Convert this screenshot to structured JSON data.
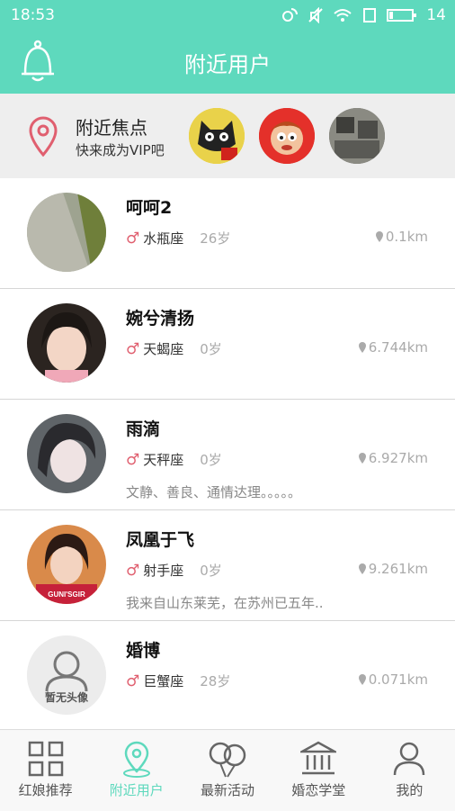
{
  "status_bar": {
    "time": "18:53",
    "battery": "14"
  },
  "header": {
    "title": "附近用户"
  },
  "focus": {
    "title": "附近焦点",
    "subtitle": "快来成为VIP吧"
  },
  "users": [
    {
      "name": "呵呵2",
      "zodiac": "水瓶座",
      "age": "26岁",
      "distance": "0.1km",
      "signature": ""
    },
    {
      "name": "婉兮清扬",
      "zodiac": "天蝎座",
      "age": "0岁",
      "distance": "6.744km",
      "signature": ""
    },
    {
      "name": "雨滴",
      "zodiac": "天秤座",
      "age": "0岁",
      "distance": "6.927km",
      "signature": "文静、善良、通情达理。。。。。"
    },
    {
      "name": "凤凰于飞",
      "zodiac": "射手座",
      "age": "0岁",
      "distance": "9.261km",
      "signature": "我来自山东莱芜，在苏州已五年.."
    },
    {
      "name": "婚博",
      "zodiac": "巨蟹座",
      "age": "28岁",
      "distance": "0.071km",
      "signature": "",
      "avatar_text": "暂无头像"
    }
  ],
  "tabs": [
    {
      "label": "红娘推荐",
      "icon": "grid-icon"
    },
    {
      "label": "附近用户",
      "icon": "location-icon",
      "active": true
    },
    {
      "label": "最新活动",
      "icon": "balloons-icon"
    },
    {
      "label": "婚恋学堂",
      "icon": "institution-icon"
    },
    {
      "label": "我的",
      "icon": "person-icon"
    }
  ],
  "colors": {
    "accent": "#5ed9bd",
    "gender_male": "#e05f6f"
  }
}
